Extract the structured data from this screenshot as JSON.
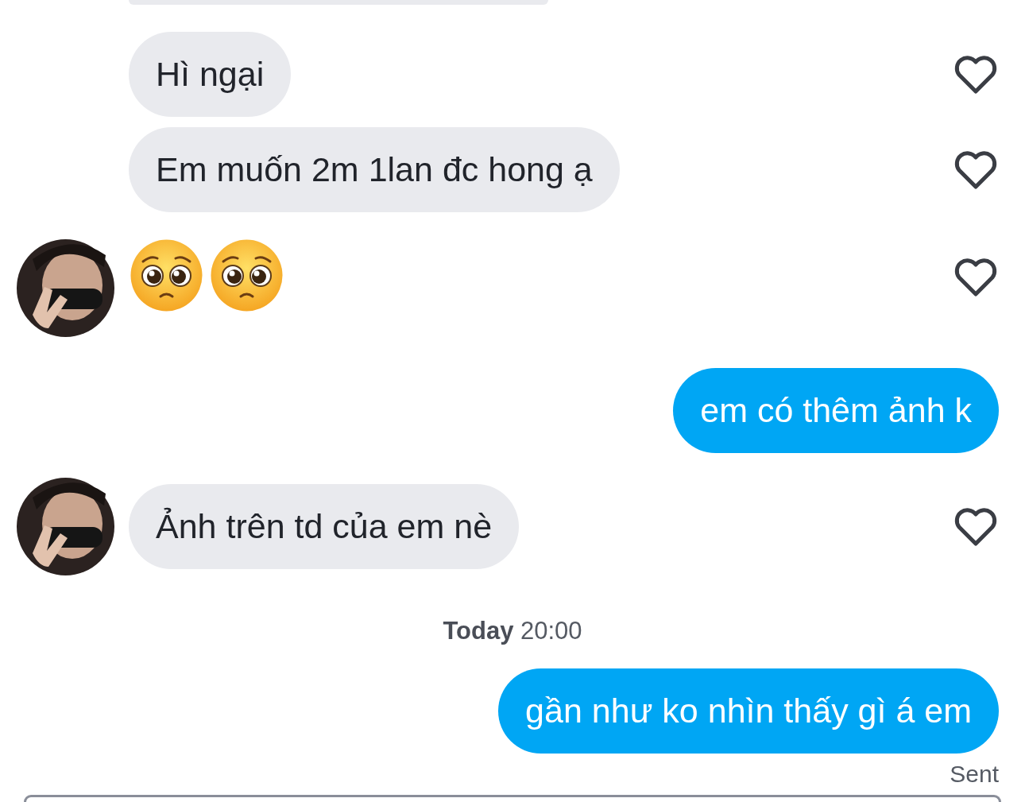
{
  "messages": [
    {
      "kind": "cut_off"
    },
    {
      "kind": "received",
      "text": "Hì ngại",
      "avatar": false,
      "liked": false
    },
    {
      "kind": "received",
      "text": "Em muốn 2m 1lan đc hong ạ",
      "avatar": false,
      "liked": false
    },
    {
      "kind": "emoji",
      "emojis": [
        {
          "kind": "pleading"
        },
        {
          "kind": "pleading"
        }
      ],
      "avatar": true,
      "liked": false
    },
    {
      "kind": "sent",
      "text": "em có thêm ảnh k"
    },
    {
      "kind": "received",
      "text": "Ảnh trên td của em nè",
      "avatar": true,
      "liked": false
    },
    {
      "kind": "timestamp",
      "text": "**Today** 20:00"
    },
    {
      "kind": "sent",
      "text": "gần như ko nhìn thấy gì á em"
    },
    {
      "kind": "status",
      "text": "Sent"
    }
  ],
  "message_field": {
    "cut_off": true
  }
}
